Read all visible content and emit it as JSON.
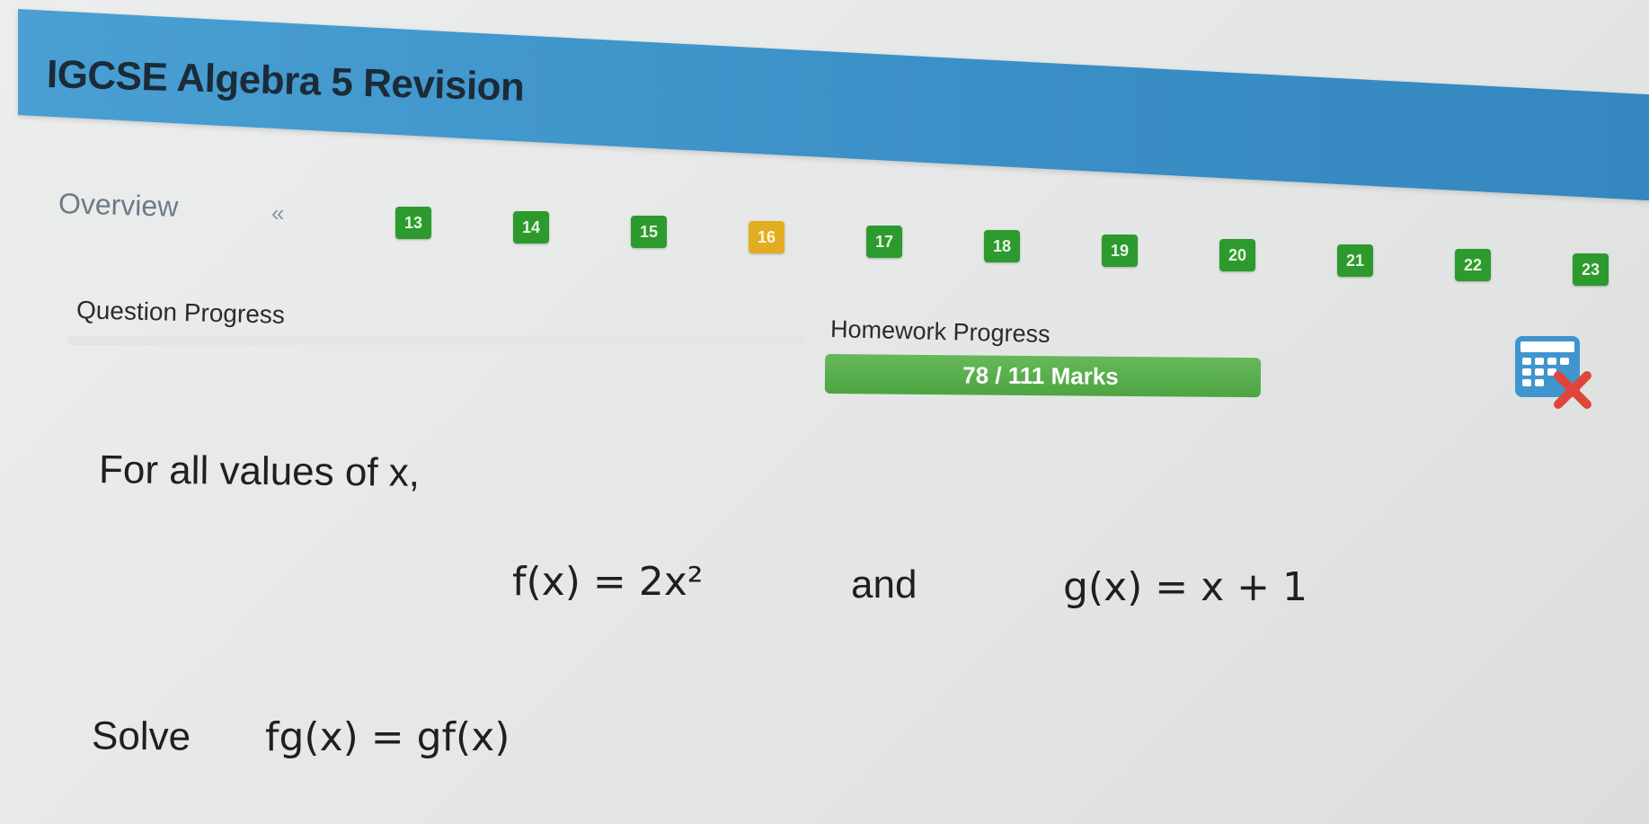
{
  "header": {
    "title": "IGCSE Algebra 5 Revision"
  },
  "nav": {
    "overview_label": "Overview",
    "prev_label": "«",
    "questions": [
      {
        "label": "13",
        "current": false
      },
      {
        "label": "14",
        "current": false
      },
      {
        "label": "15",
        "current": false
      },
      {
        "label": "16",
        "current": true
      },
      {
        "label": "17",
        "current": false
      },
      {
        "label": "18",
        "current": false
      },
      {
        "label": "19",
        "current": false
      },
      {
        "label": "20",
        "current": false
      },
      {
        "label": "21",
        "current": false
      },
      {
        "label": "22",
        "current": false
      },
      {
        "label": "23",
        "current": false
      }
    ]
  },
  "progress": {
    "question_label": "Question Progress",
    "homework_label": "Homework Progress",
    "homework_text": "78 / 111 Marks",
    "homework_fraction": 0.7027
  },
  "tools": {
    "calculator_icon": "calculator-not-allowed-icon"
  },
  "question": {
    "intro": "For all values of x,",
    "f_def": "f(x) = 2x²",
    "connector": "and",
    "g_def": "g(x) = x + 1",
    "solve_word": "Solve",
    "solve_expr": "fg(x) = gf(x)"
  },
  "colors": {
    "header_blue": "#3f95cd",
    "button_green": "#2d9a2d",
    "current_yellow": "#e2ad20",
    "progress_green": "#55aa48"
  }
}
